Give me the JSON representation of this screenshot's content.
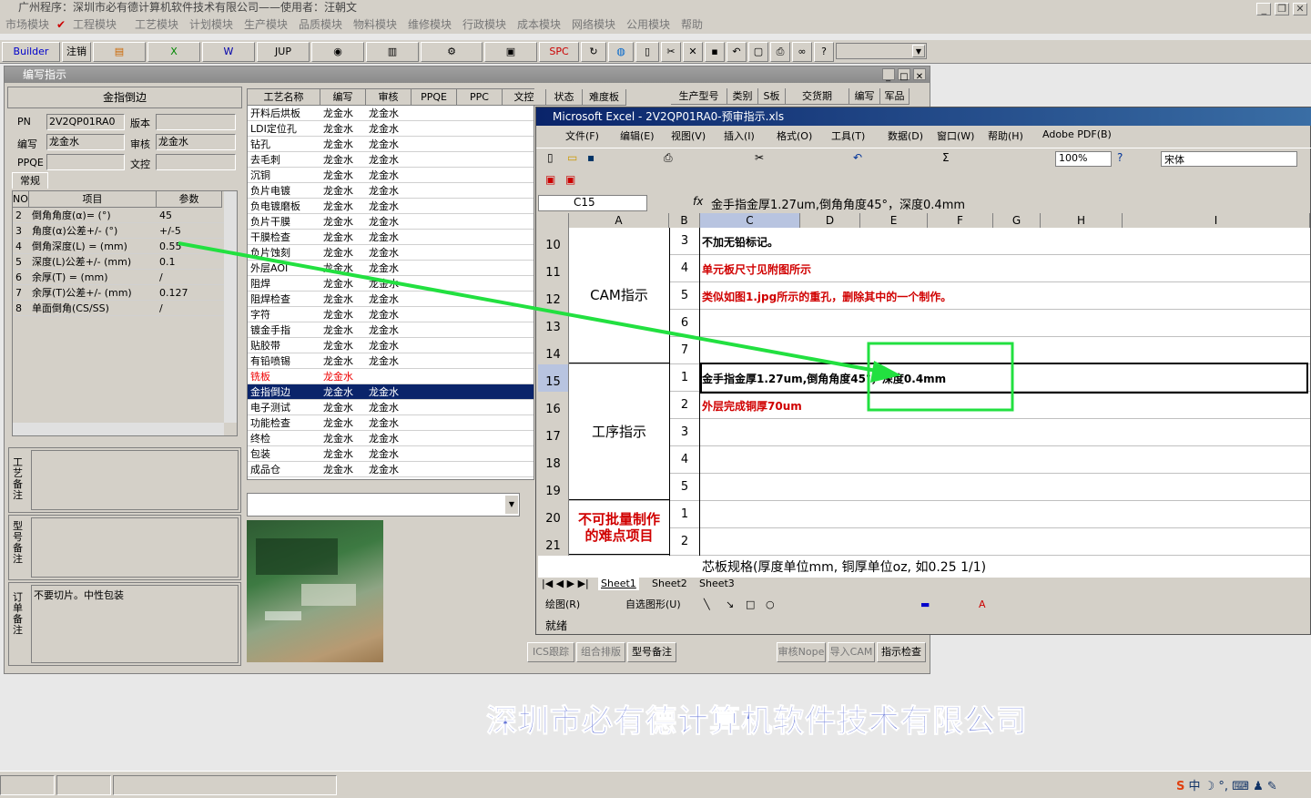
{
  "app": {
    "title": "广州程序：深圳市必有德计算机软件技术有限公司——使用者：汪朝文"
  },
  "menu": [
    "市场模块",
    "工程模块",
    "工艺模块",
    "计划模块",
    "生产模块",
    "品质模块",
    "物料模块",
    "维修模块",
    "行政模块",
    "成本模块",
    "网络模块",
    "公用模块",
    "帮助"
  ],
  "toolbar": {
    "builder": "Builder",
    "logout": "注销",
    "jup": "JUP",
    "spc": "SPC"
  },
  "window": {
    "title": "编写指示"
  },
  "section": {
    "title": "金指倒边"
  },
  "form": {
    "pn_label": "PN",
    "pn_value": "2V2QP01RA0",
    "version_label": "版本",
    "author_label": "编写",
    "author_value": "龙金水",
    "review_label": "审核",
    "review_value": "龙金水",
    "ppqe_label": "PPQE",
    "text_label": "文控",
    "tab": "常规"
  },
  "params": {
    "headers": [
      "NO",
      "项目",
      "参数"
    ],
    "rows": [
      [
        "2",
        "倒角角度(α)= (°)",
        "45"
      ],
      [
        "3",
        "角度(α)公差+/- (°)",
        "+/-5"
      ],
      [
        "4",
        "倒角深度(L) = (mm)",
        "0.55"
      ],
      [
        "5",
        "深度(L)公差+/- (mm)",
        "0.1"
      ],
      [
        "6",
        "余厚(T) = (mm)",
        "/"
      ],
      [
        "7",
        "余厚(T)公差+/- (mm)",
        "0.127"
      ],
      [
        "8",
        "单面倒角(CS/SS)",
        "/"
      ]
    ]
  },
  "notes": {
    "process_label": "工艺备注",
    "model_label": "型号备注",
    "order_label": "订单备注",
    "order_text": "不要切片。中性包装"
  },
  "process": {
    "headers": [
      "工艺名称",
      "编写",
      "审核",
      "PPQE",
      "PPC",
      "文控",
      "状态",
      "难度板"
    ],
    "rows": [
      [
        "开料后烘板",
        "龙金水",
        "龙金水"
      ],
      [
        "LDI定位孔",
        "龙金水",
        "龙金水"
      ],
      [
        "钻孔",
        "龙金水",
        "龙金水"
      ],
      [
        "去毛刺",
        "龙金水",
        "龙金水"
      ],
      [
        "沉铜",
        "龙金水",
        "龙金水"
      ],
      [
        "负片电镀",
        "龙金水",
        "龙金水"
      ],
      [
        "负电镀磨板",
        "龙金水",
        "龙金水"
      ],
      [
        "负片干膜",
        "龙金水",
        "龙金水"
      ],
      [
        "干膜检查",
        "龙金水",
        "龙金水"
      ],
      [
        "负片蚀刻",
        "龙金水",
        "龙金水"
      ],
      [
        "外层AOI",
        "龙金水",
        "龙金水"
      ],
      [
        "阻焊",
        "龙金水",
        "龙金水"
      ],
      [
        "阻焊检查",
        "龙金水",
        "龙金水"
      ],
      [
        "字符",
        "龙金水",
        "龙金水"
      ],
      [
        "镀金手指",
        "龙金水",
        "龙金水"
      ],
      [
        "贴胶带",
        "龙金水",
        "龙金水"
      ],
      [
        "有铅喷锡",
        "龙金水",
        "龙金水"
      ],
      [
        "铣板",
        "龙金水",
        ""
      ],
      [
        "金指倒边",
        "龙金水",
        "龙金水"
      ],
      [
        "电子测试",
        "龙金水",
        "龙金水"
      ],
      [
        "功能检查",
        "龙金水",
        "龙金水"
      ],
      [
        "终检",
        "龙金水",
        "龙金水"
      ],
      [
        "包装",
        "龙金水",
        "龙金水"
      ],
      [
        "成品仓",
        "龙金水",
        "龙金水"
      ]
    ]
  },
  "right_headers": [
    "生产型号",
    "类别",
    "S板",
    "交货期",
    "编写",
    "军品"
  ],
  "bottom_tabs": [
    "ICS跟踪",
    "组合排版",
    "型号备注",
    "审核Nope",
    "导入CAM",
    "指示检查"
  ],
  "excel": {
    "title": "Microsoft Excel - 2V2QP01RA0-预审指示.xls",
    "menu": [
      "文件(F)",
      "编辑(E)",
      "视图(V)",
      "插入(I)",
      "格式(O)",
      "工具(T)",
      "数据(D)",
      "窗口(W)",
      "帮助(H)",
      "Adobe PDF(B)"
    ],
    "zoom": "100%",
    "font": "宋体",
    "cellref": "C15",
    "formula": "金手指金厚1.27um,倒角角度45°，深度0.4mm",
    "columns": [
      "A",
      "B",
      "C",
      "D",
      "E",
      "F",
      "G",
      "H",
      "I"
    ],
    "rows": [
      {
        "n": "10",
        "b": "3",
        "c": "不加无铅标记。",
        "red": false
      },
      {
        "n": "11",
        "b": "4",
        "c": "单元板尺寸见附图所示",
        "red": true
      },
      {
        "n": "12",
        "b": "5",
        "c": "类似如图1.jpg所示的重孔，删除其中的一个制作。",
        "red": true
      },
      {
        "n": "13",
        "b": "6",
        "c": "",
        "red": false
      },
      {
        "n": "14",
        "b": "7",
        "c": "",
        "red": false
      },
      {
        "n": "15",
        "b": "1",
        "c": "金手指金厚1.27um,倒角角度45°，深度0.4mm",
        "red": false
      },
      {
        "n": "16",
        "b": "2",
        "c": "外层完成铜厚70um",
        "red": true
      },
      {
        "n": "17",
        "b": "3",
        "c": "",
        "red": false
      },
      {
        "n": "18",
        "b": "4",
        "c": "",
        "red": false
      },
      {
        "n": "19",
        "b": "5",
        "c": "",
        "red": false
      },
      {
        "n": "20",
        "b": "1",
        "c": "",
        "red": false
      },
      {
        "n": "21",
        "b": "2",
        "c": "",
        "red": false
      }
    ],
    "groupA": [
      "CAM指示",
      "工序指示",
      "不可批量制作的难点项目"
    ],
    "row22": "芯板规格(厚度单位mm, 铜厚单位oz, 如0.25 1/1)",
    "sheets": [
      "Sheet1",
      "Sheet2",
      "Sheet3"
    ],
    "drawing": "绘图(R)",
    "autoshape": "自选图形(U)",
    "status": "就绪"
  },
  "watermark": "深圳市必有德计算机软件技术有限公司"
}
